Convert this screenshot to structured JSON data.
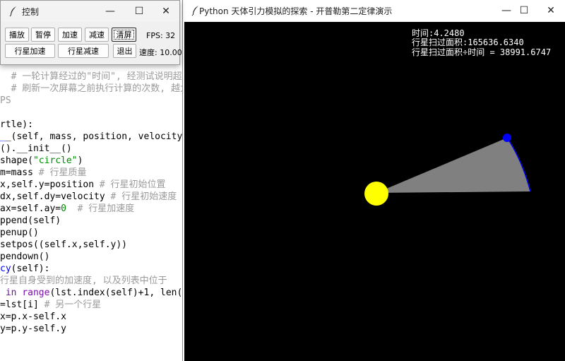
{
  "editor": {
    "lines": [
      {
        "segments": [
          {
            "t": "  ",
            "c": "default"
          },
          {
            "t": "# 一轮计算经过的\"时间\", 经测试说明超",
            "c": "comment"
          }
        ]
      },
      {
        "segments": [
          {
            "t": "  ",
            "c": "default"
          },
          {
            "t": "# 刷新一次屏幕之前执行计算的次数, 越大",
            "c": "comment"
          }
        ]
      },
      {
        "segments": [
          {
            "t": "PS",
            "c": "comment"
          }
        ]
      },
      {
        "segments": [
          {
            "t": "",
            "c": "default"
          }
        ]
      },
      {
        "segments": [
          {
            "t": "rtle):",
            "c": "default"
          }
        ]
      },
      {
        "segments": [
          {
            "t": "_",
            "c": "def"
          },
          {
            "t": "_(self, mass, position, velocity",
            "c": "default"
          }
        ]
      },
      {
        "segments": [
          {
            "t": "().__init__()",
            "c": "default"
          }
        ]
      },
      {
        "segments": [
          {
            "t": "shape(",
            "c": "default"
          },
          {
            "t": "\"circle\"",
            "c": "string"
          },
          {
            "t": ")",
            "c": "default"
          }
        ]
      },
      {
        "segments": [
          {
            "t": "m=mass ",
            "c": "default"
          },
          {
            "t": "# 行星质量",
            "c": "comment"
          }
        ]
      },
      {
        "segments": [
          {
            "t": "x,self.y=position ",
            "c": "default"
          },
          {
            "t": "# 行星初始位置",
            "c": "comment"
          }
        ]
      },
      {
        "segments": [
          {
            "t": "dx,self.dy=velocity ",
            "c": "default"
          },
          {
            "t": "# 行星初始速度",
            "c": "comment"
          }
        ]
      },
      {
        "segments": [
          {
            "t": "ax=self.ay=",
            "c": "default"
          },
          {
            "t": "0",
            "c": "string"
          },
          {
            "t": "  ",
            "c": "default"
          },
          {
            "t": "# 行星加速度",
            "c": "comment"
          }
        ]
      },
      {
        "segments": [
          {
            "t": "ppend(self)",
            "c": "default"
          }
        ]
      },
      {
        "segments": [
          {
            "t": "penup()",
            "c": "default"
          }
        ]
      },
      {
        "segments": [
          {
            "t": "setpos((self.x,self.y))",
            "c": "default"
          }
        ]
      },
      {
        "segments": [
          {
            "t": "pendown()",
            "c": "default"
          }
        ]
      },
      {
        "segments": [
          {
            "t": "cy",
            "c": "def"
          },
          {
            "t": "(self):",
            "c": "default"
          }
        ]
      },
      {
        "segments": [
          {
            "t": "行星自身受到的加速度, 以及列表中位于",
            "c": "comment"
          }
        ]
      },
      {
        "segments": [
          {
            "t": " in ",
            "c": "keyword"
          },
          {
            "t": "range",
            "c": "keyword"
          },
          {
            "t": "(lst.index(self)+",
            "c": "default"
          },
          {
            "t": "1",
            "c": "default"
          },
          {
            "t": ", len(l",
            "c": "default"
          }
        ]
      },
      {
        "segments": [
          {
            "t": "=lst[i] ",
            "c": "default"
          },
          {
            "t": "# 另一个行星",
            "c": "comment"
          }
        ]
      },
      {
        "segments": [
          {
            "t": "x=p.x-self.x",
            "c": "default"
          }
        ]
      },
      {
        "segments": [
          {
            "t": "y=p.y-self.y",
            "c": "default"
          }
        ]
      }
    ]
  },
  "control_window": {
    "title": "控制",
    "buttons_row1": [
      "播放",
      "暂停",
      "加速",
      "减速",
      "清屏"
    ],
    "fps_text": "FPS: 32",
    "buttons_row2": [
      "行星加速",
      "行星减速",
      "退出"
    ],
    "speed_text": "速度: 10.00",
    "minimize_glyph": "—",
    "maximize_glyph": "☐",
    "close_glyph": "✕"
  },
  "sim_window": {
    "title": "Python 天体引力模拟的探索 - 开普勒第二定律演示",
    "minimize_glyph": "—",
    "maximize_glyph": "☐",
    "close_glyph": "✕",
    "hud": {
      "time_text": "时间:4.2480",
      "area_text": "行星扫过面积:165636.6340",
      "ratio_text": "行星扫过面积÷时间 = 38991.6747"
    }
  },
  "colors": {
    "sun": "#ffff00",
    "planet": "#0000ff",
    "swept_area": "#808080",
    "orbit": "#0000ff",
    "canvas_bg": "#000000"
  }
}
